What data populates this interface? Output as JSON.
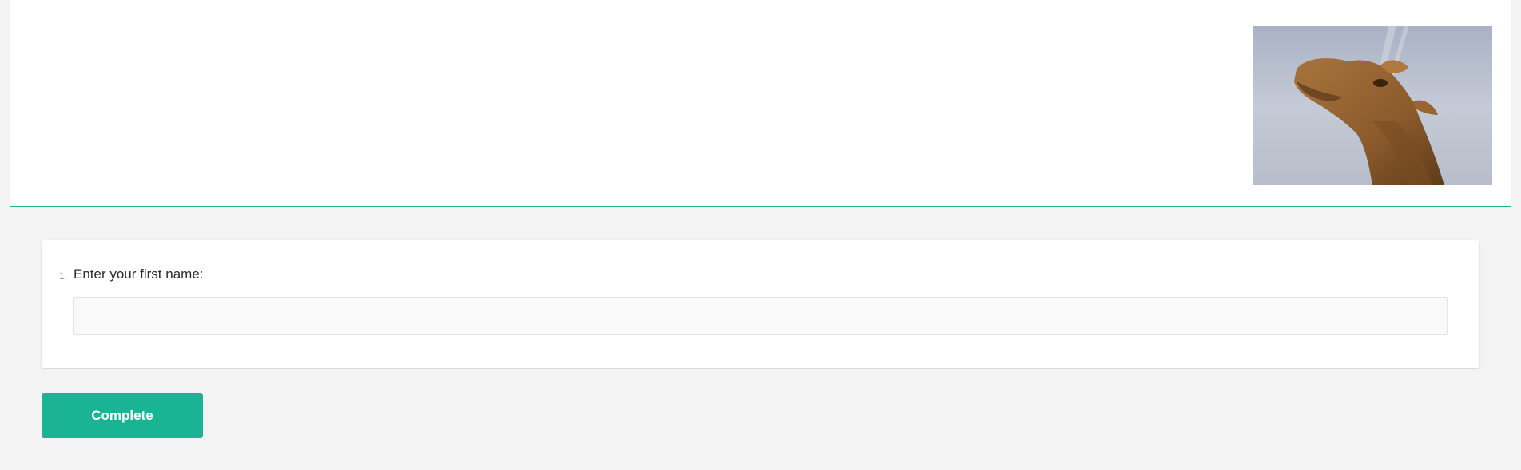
{
  "header": {
    "logo_icon": "camel-photo-logo",
    "accent_color": "#1ab394"
  },
  "question": {
    "number": "1.",
    "title": "Enter your first name:",
    "value": "",
    "placeholder": ""
  },
  "actions": {
    "complete_label": "Complete"
  },
  "colors": {
    "background": "#f3f3f3",
    "card": "#ffffff",
    "button": "#1ab394"
  }
}
